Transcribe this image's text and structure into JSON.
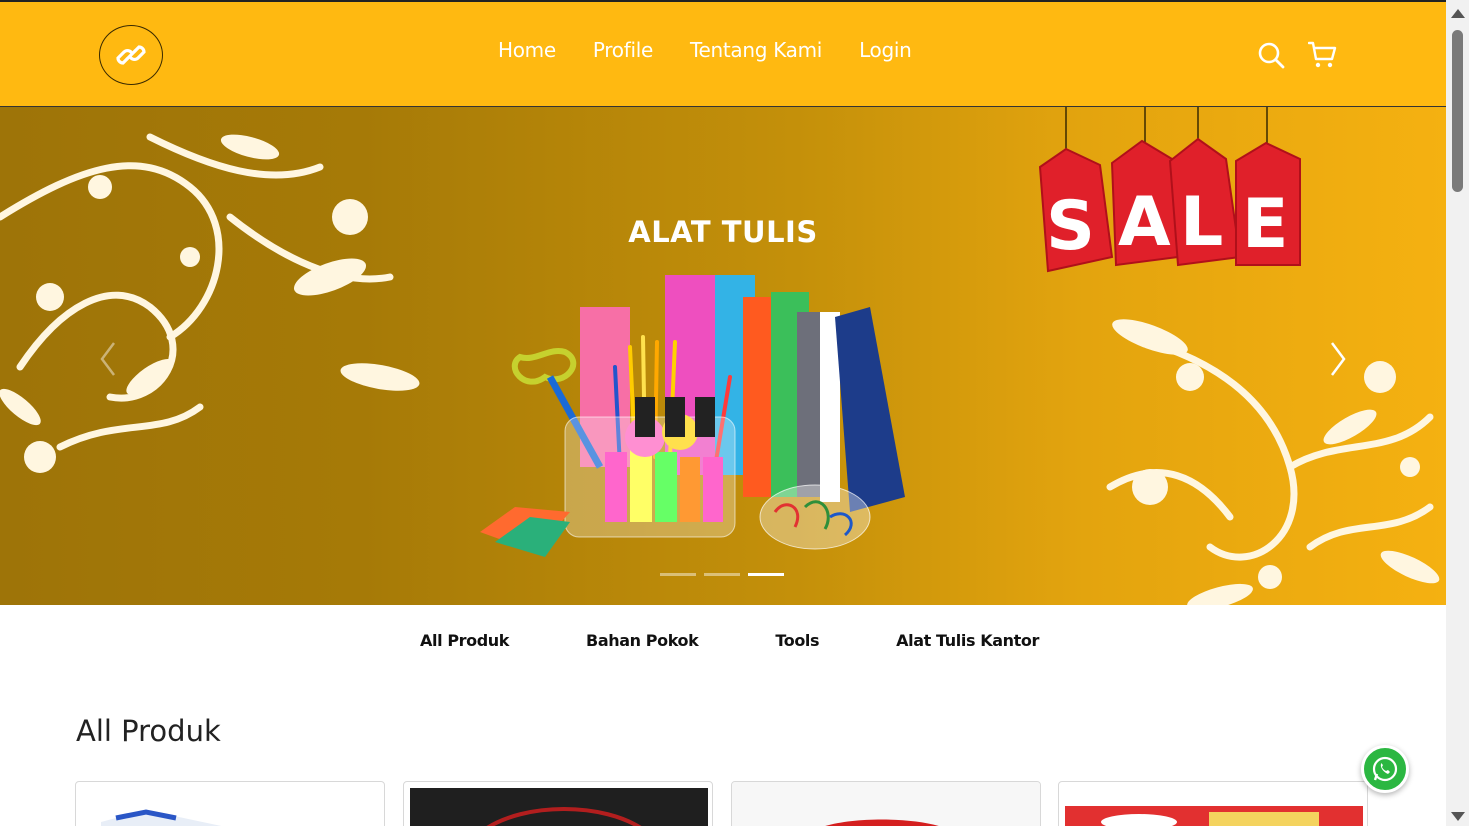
{
  "nav": {
    "links": [
      "Home",
      "Profile",
      "Tentang Kami",
      "Login"
    ],
    "icons": [
      "logo-link-icon",
      "search-icon",
      "cart-icon"
    ]
  },
  "hero": {
    "title": "ALAT TULIS",
    "sale_text": "SALE",
    "slide_count": 3,
    "active_slide": 3
  },
  "categories": [
    "All Produk",
    "Bahan Pokok",
    "Tools",
    "Alat Tulis Kantor"
  ],
  "section": {
    "title": "All Produk"
  },
  "colors": {
    "brand": "#ffb911",
    "hero_dark": "#9e7408",
    "whatsapp": "#2bb741",
    "sale_tag": "#e0202a"
  }
}
